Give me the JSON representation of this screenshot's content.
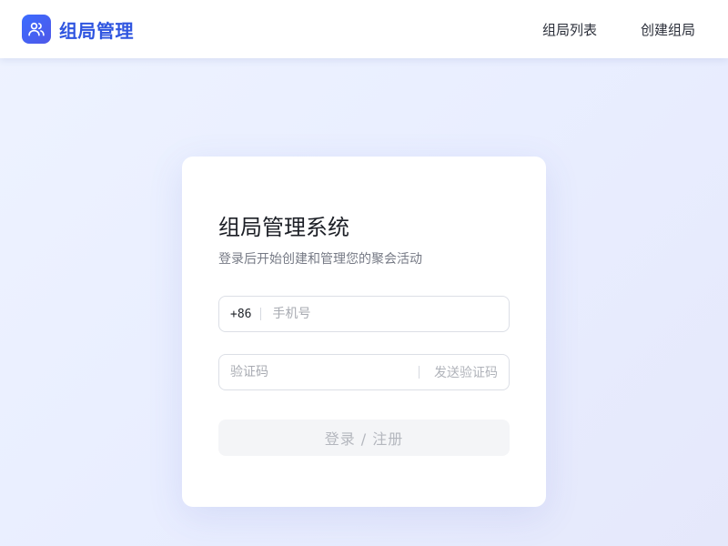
{
  "header": {
    "brand_title": "组局管理",
    "logo_icon": "users-icon",
    "nav": [
      {
        "label": "组局列表"
      },
      {
        "label": "创建组局"
      }
    ]
  },
  "login_card": {
    "title": "组局管理系统",
    "subtitle": "登录后开始创建和管理您的聚会活动",
    "phone": {
      "prefix": "+86",
      "placeholder": "手机号",
      "value": ""
    },
    "code": {
      "placeholder": "验证码",
      "value": "",
      "send_label": "发送验证码"
    },
    "submit_label": "登录 / 注册"
  },
  "colors": {
    "brand": "#2f55e0",
    "logo_gradient_start": "#3b6cff",
    "logo_gradient_end": "#4f58e8",
    "disabled_button_bg": "#f4f5f7",
    "disabled_text": "#b4b7be"
  }
}
